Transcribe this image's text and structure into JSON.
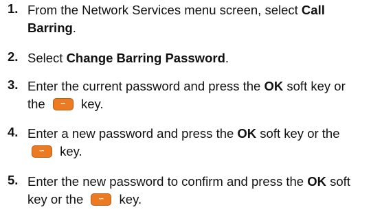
{
  "steps": [
    {
      "number": "1.",
      "parts": [
        {
          "type": "text",
          "text": "From the Network Services menu screen, select "
        },
        {
          "type": "bold",
          "text": "Call Barring"
        },
        {
          "type": "text",
          "text": "."
        }
      ]
    },
    {
      "number": "2.",
      "parts": [
        {
          "type": "text",
          "text": "Select "
        },
        {
          "type": "bold",
          "text": "Change Barring Password"
        },
        {
          "type": "text",
          "text": "."
        }
      ]
    },
    {
      "number": "3.",
      "parts": [
        {
          "type": "text",
          "text": "Enter the current password and press the "
        },
        {
          "type": "bold",
          "text": "OK"
        },
        {
          "type": "text",
          "text": " soft key or the "
        },
        {
          "type": "key",
          "icon": "soft-key-icon"
        },
        {
          "type": "text",
          "text": " key."
        }
      ]
    },
    {
      "number": "4.",
      "parts": [
        {
          "type": "text",
          "text": "Enter a new password and press the "
        },
        {
          "type": "bold",
          "text": "OK"
        },
        {
          "type": "text",
          "text": " soft key or the "
        },
        {
          "type": "key",
          "icon": "soft-key-icon"
        },
        {
          "type": "text",
          "text": " key."
        }
      ]
    },
    {
      "number": "5.",
      "parts": [
        {
          "type": "text",
          "text": "Enter the new password to confirm and press the "
        },
        {
          "type": "bold",
          "text": "OK"
        },
        {
          "type": "text",
          "text": " soft key or the "
        },
        {
          "type": "key",
          "icon": "soft-key-icon"
        },
        {
          "type": "text",
          "text": " key."
        }
      ]
    }
  ],
  "key_icon": {
    "glyph": "∽",
    "fill_color": "#ec7a22",
    "border_color": "#b85a12"
  }
}
